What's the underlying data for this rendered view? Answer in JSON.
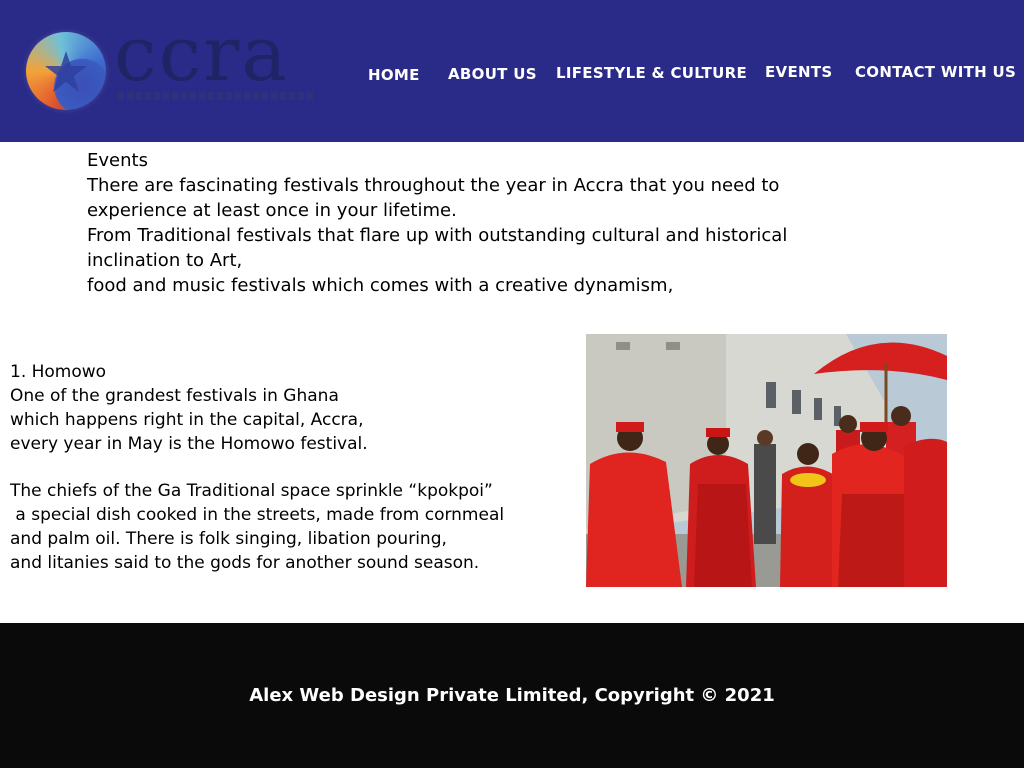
{
  "header": {
    "background_color": "#2a2b88",
    "logo_text": "ccra"
  },
  "nav": {
    "home": "HOME",
    "about": "ABOUT US",
    "lifestyle": "LIFESTYLE & CULTURE",
    "events": "EVENTS",
    "contact": "CONTACT WITH US"
  },
  "intro": {
    "heading": "Events",
    "lines": [
      "There are fascinating festivals throughout the year in Accra that you need to",
      "experience at least once in your lifetime.",
      "From Traditional festivals that flare up with outstanding cultural and historical",
      "inclination to Art,",
      "food and music festivals which comes with a creative dynamism,"
    ]
  },
  "homowo": {
    "title": "1. Homowo",
    "para1": [
      "One of the grandest festivals in Ghana",
      "which happens right in the capital, Accra,",
      "every year in May is the Homowo festival."
    ],
    "para2": [
      "The chiefs of the Ga Traditional space sprinkle “kpokpoi”",
      " a special dish cooked in the streets, made from cornmeal",
      "and palm oil. There is folk singing, libation pouring,",
      "and litanies said to the gods for another sound season."
    ]
  },
  "photo": {
    "icon": "festival-photo"
  },
  "footer": {
    "text": "Alex Web Design Private Limited, Copyright © 2021",
    "background_color": "#0a0a0a"
  }
}
